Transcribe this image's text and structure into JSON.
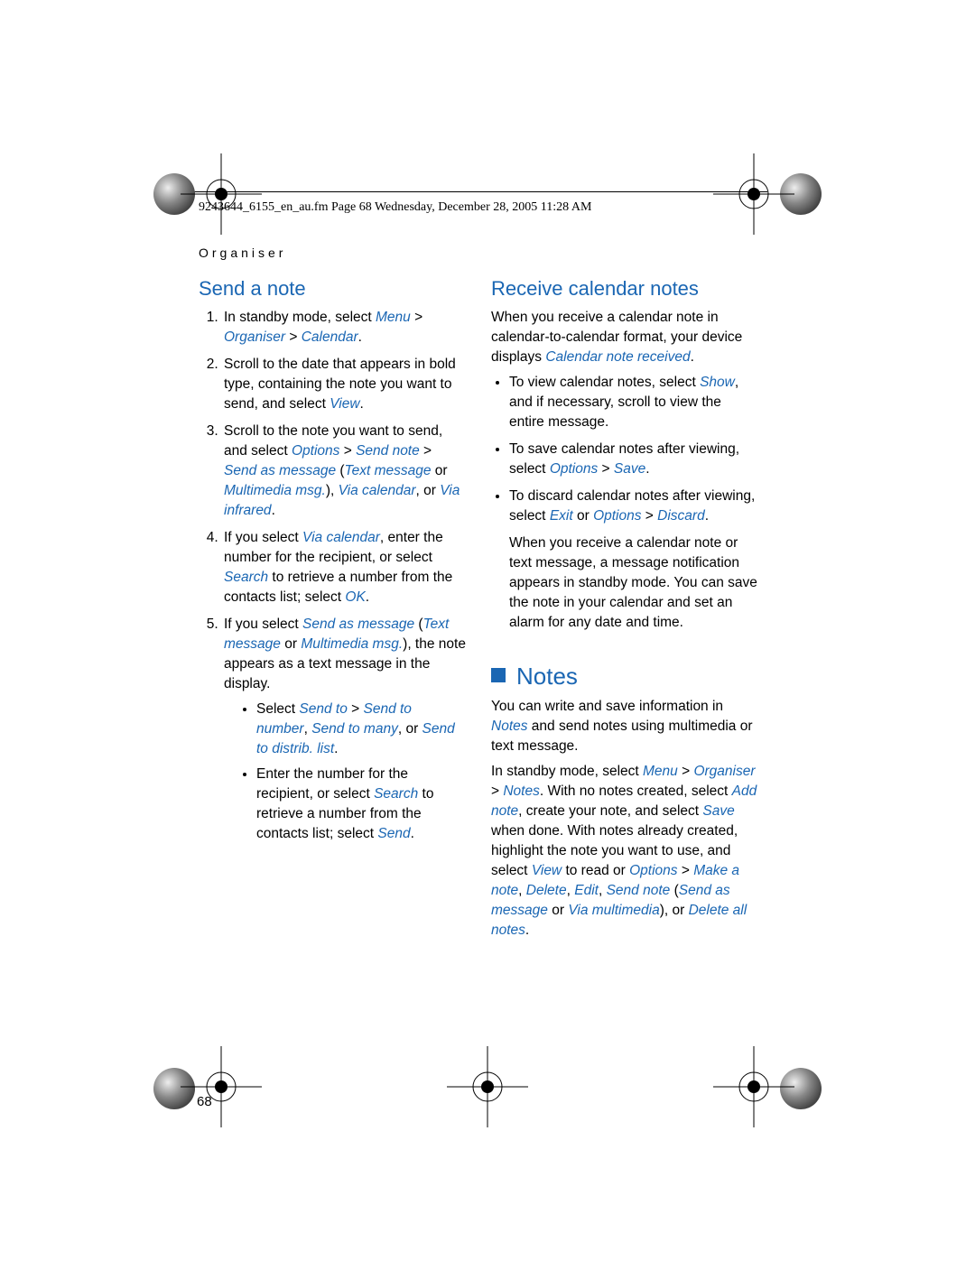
{
  "header": "9243644_6155_en_au.fm  Page 68  Wednesday, December 28, 2005  11:28 AM",
  "section_label": "Organiser",
  "page_number": "68",
  "left": {
    "h2": "Send a note",
    "s1a": "In standby mode, select ",
    "s1b": "Menu",
    "s1c": " > ",
    "s1d": "Organiser",
    "s1e": " > ",
    "s1f": "Calendar",
    "s1g": ".",
    "s2a": "Scroll to the date that appears in bold type, containing the note you want to send, and select ",
    "s2b": "View",
    "s2c": ".",
    "s3a": "Scroll to the note you want to send, and select ",
    "s3b": "Options",
    "s3c": " > ",
    "s3d": "Send note",
    "s3e": " > ",
    "s3f": "Send as message",
    "s3g": " (",
    "s3h": "Text message",
    "s3i": " or ",
    "s3j": "Multimedia msg.",
    "s3k": "), ",
    "s3l": "Via calendar",
    "s3m": ", or ",
    "s3n": "Via infrared",
    "s3o": ".",
    "s4a": "If you select ",
    "s4b": "Via calendar",
    "s4c": ", enter the number for the recipient, or select ",
    "s4d": "Search",
    "s4e": " to retrieve a number from the contacts list; select ",
    "s4f": "OK",
    "s4g": ".",
    "s5a": "If you select ",
    "s5b": "Send as message",
    "s5c": " (",
    "s5d": "Text message",
    "s5e": " or ",
    "s5f": "Multimedia msg.",
    "s5g": "), the note appears as a text message in the display.",
    "b1a": "Select ",
    "b1b": "Send to",
    "b1c": " > ",
    "b1d": "Send to number",
    "b1e": ", ",
    "b1f": "Send to many",
    "b1g": ", or ",
    "b1h": "Send to distrib. list",
    "b1i": ".",
    "b2a": "Enter the number for the recipient, or select ",
    "b2b": "Search",
    "b2c": " to retrieve a number from the contacts list; select ",
    "b2d": "Send",
    "b2e": "."
  },
  "right": {
    "h2": "Receive calendar notes",
    "p1a": "When you receive a calendar note in calendar-to-calendar format, your device displays ",
    "p1b": "Calendar note received",
    "p1c": ".",
    "r1a": "To view calendar notes, select ",
    "r1b": "Show",
    "r1c": ", and if necessary, scroll to view the entire message.",
    "r2a": "To save calendar notes after viewing, select ",
    "r2b": "Options",
    "r2c": " > ",
    "r2d": "Save",
    "r2e": ".",
    "r3a": "To discard calendar notes after viewing, select ",
    "r3b": "Exit",
    "r3c": " or ",
    "r3d": "Options",
    "r3e": " > ",
    "r3f": "Discard",
    "r3g": ".",
    "p2": "When you receive a calendar note or text message, a message notification appears in standby mode. You can save the note in your calendar and set an alarm for any date and time.",
    "h1": "Notes",
    "n1a": "You can write and save information in ",
    "n1b": "Notes",
    "n1c": " and send notes using multimedia or text message.",
    "n2a": "In standby mode, select ",
    "n2b": "Menu",
    "n2c": " > ",
    "n2d": "Organiser",
    "n2e": " > ",
    "n2f": "Notes",
    "n2g": ". With no notes created, select ",
    "n2h": "Add note",
    "n2i": ", create your note, and select ",
    "n2j": "Save",
    "n2k": " when done. With notes already created, highlight the note you want to use, and select ",
    "n2l": "View",
    "n2m": " to read or ",
    "n2n": "Options",
    "n2o": " > ",
    "n2p": "Make a note",
    "n2q": ", ",
    "n2r": "Delete",
    "n2s": ", ",
    "n2t": "Edit",
    "n2u": ", ",
    "n2v": "Send note",
    "n2w": " (",
    "n2x": "Send as message",
    "n2y": " or ",
    "n2z": "Via multimedia",
    "n2aa": "), or ",
    "n2ab": "Delete all notes",
    "n2ac": "."
  }
}
